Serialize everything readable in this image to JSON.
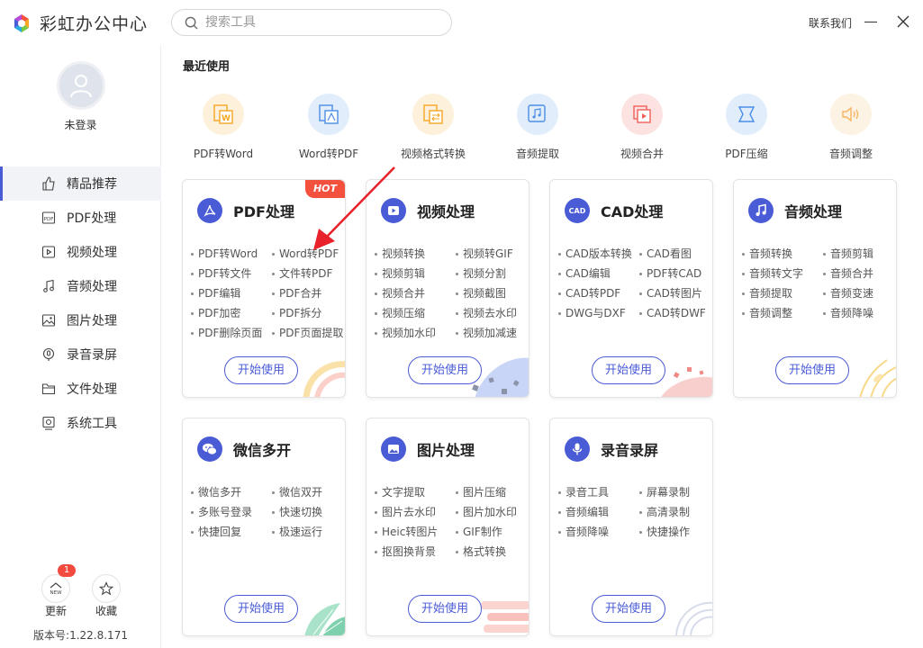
{
  "app": {
    "title": "彩虹办公中心"
  },
  "search": {
    "placeholder": "搜索工具"
  },
  "header": {
    "contact": "联系我们"
  },
  "user": {
    "status": "未登录"
  },
  "sidebar": {
    "items": [
      {
        "label": "精品推荐",
        "icon": "thumbs-up-icon"
      },
      {
        "label": "PDF处理",
        "icon": "pdf-icon"
      },
      {
        "label": "视频处理",
        "icon": "video-icon"
      },
      {
        "label": "音频处理",
        "icon": "music-note-icon"
      },
      {
        "label": "图片处理",
        "icon": "image-icon"
      },
      {
        "label": "录音录屏",
        "icon": "record-icon"
      },
      {
        "label": "文件处理",
        "icon": "folder-icon"
      },
      {
        "label": "系统工具",
        "icon": "gear-icon"
      }
    ],
    "update_label": "更新",
    "update_badge": "1",
    "update_icon_text": "NEW",
    "favorite_label": "收藏",
    "version": "版本号:1.22.8.171"
  },
  "recent": {
    "title": "最近使用",
    "items": [
      {
        "label": "PDF转Word",
        "color": "#f5a623"
      },
      {
        "label": "Word转PDF",
        "color": "#4a8ee6"
      },
      {
        "label": "视频格式转换",
        "color": "#f5a623"
      },
      {
        "label": "音频提取",
        "color": "#4a8ee6"
      },
      {
        "label": "视频合并",
        "color": "#f0605a"
      },
      {
        "label": "PDF压缩",
        "color": "#4a8ee6"
      },
      {
        "label": "音频调整",
        "color": "#f5b460"
      }
    ]
  },
  "cards": [
    {
      "title": "PDF处理",
      "hot": "HOT",
      "features": [
        "PDF转Word",
        "Word转PDF",
        "PDF转文件",
        "文件转PDF",
        "PDF编辑",
        "PDF合并",
        "PDF加密",
        "PDF拆分",
        "PDF删除页面",
        "PDF页面提取"
      ],
      "button": "开始使用"
    },
    {
      "title": "视频处理",
      "features": [
        "视频转换",
        "视频转GIF",
        "视频剪辑",
        "视频分割",
        "视频合并",
        "视频截图",
        "视频压缩",
        "视频去水印",
        "视频加水印",
        "视频加减速"
      ],
      "button": "开始使用"
    },
    {
      "title": "CAD处理",
      "icon_text": "CAD",
      "features": [
        "CAD版本转换",
        "CAD看图",
        "CAD编辑",
        "PDF转CAD",
        "CAD转PDF",
        "CAD转图片",
        "DWG与DXF",
        "CAD转DWF"
      ],
      "button": "开始使用"
    },
    {
      "title": "音频处理",
      "features": [
        "音频转换",
        "音频剪辑",
        "音频转文字",
        "音频合并",
        "音频提取",
        "音频变速",
        "音频调整",
        "音频降噪"
      ],
      "button": "开始使用"
    },
    {
      "title": "微信多开",
      "features": [
        "微信多开",
        "微信双开",
        "多账号登录",
        "快速切换",
        "快捷回复",
        "极速运行"
      ],
      "button": "开始使用"
    },
    {
      "title": "图片处理",
      "features": [
        "文字提取",
        "图片压缩",
        "图片去水印",
        "图片加水印",
        "Heic转图片",
        "GIF制作",
        "抠图换背景",
        "格式转换"
      ],
      "button": "开始使用"
    },
    {
      "title": "录音录屏",
      "features": [
        "录音工具",
        "屏幕录制",
        "音频编辑",
        "高清录制",
        "音频降噪",
        "快捷操作"
      ],
      "button": "开始使用"
    }
  ],
  "colors": {
    "accent": "#4a5bd6",
    "hot": "#f4503e",
    "arrow": "#e8212a"
  }
}
